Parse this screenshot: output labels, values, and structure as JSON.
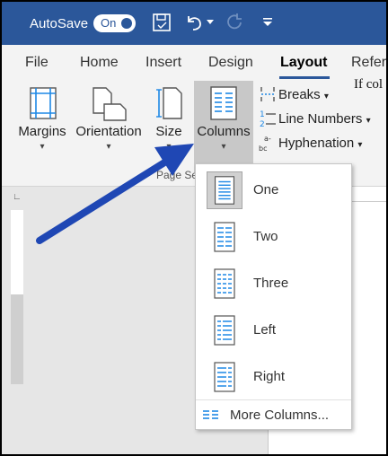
{
  "titlebar": {
    "autosave_label": "AutoSave",
    "toggle_text": "On"
  },
  "tabs": [
    {
      "label": "File"
    },
    {
      "label": "Home"
    },
    {
      "label": "Insert"
    },
    {
      "label": "Design"
    },
    {
      "label": "Layout"
    },
    {
      "label": "Refer"
    }
  ],
  "ribbon": {
    "margins": "Margins",
    "orientation": "Orientation",
    "size": "Size",
    "columns": "Columns",
    "group_label": "Page Se",
    "breaks": "Breaks",
    "line_numbers": "Line Numbers",
    "hyphenation": "Hyphenation"
  },
  "columns_menu": {
    "items": [
      {
        "label": "One",
        "selected": true
      },
      {
        "label": "Two"
      },
      {
        "label": "Three"
      },
      {
        "label": "Left"
      },
      {
        "label": "Right"
      }
    ],
    "more_label": "More Columns..."
  },
  "document": {
    "text": "If col"
  },
  "colors": {
    "title_bar": "#2b579a",
    "accent_blue": "#1e88e5",
    "arrow": "#1f47b4",
    "ribbon": "#f3f3f3"
  }
}
